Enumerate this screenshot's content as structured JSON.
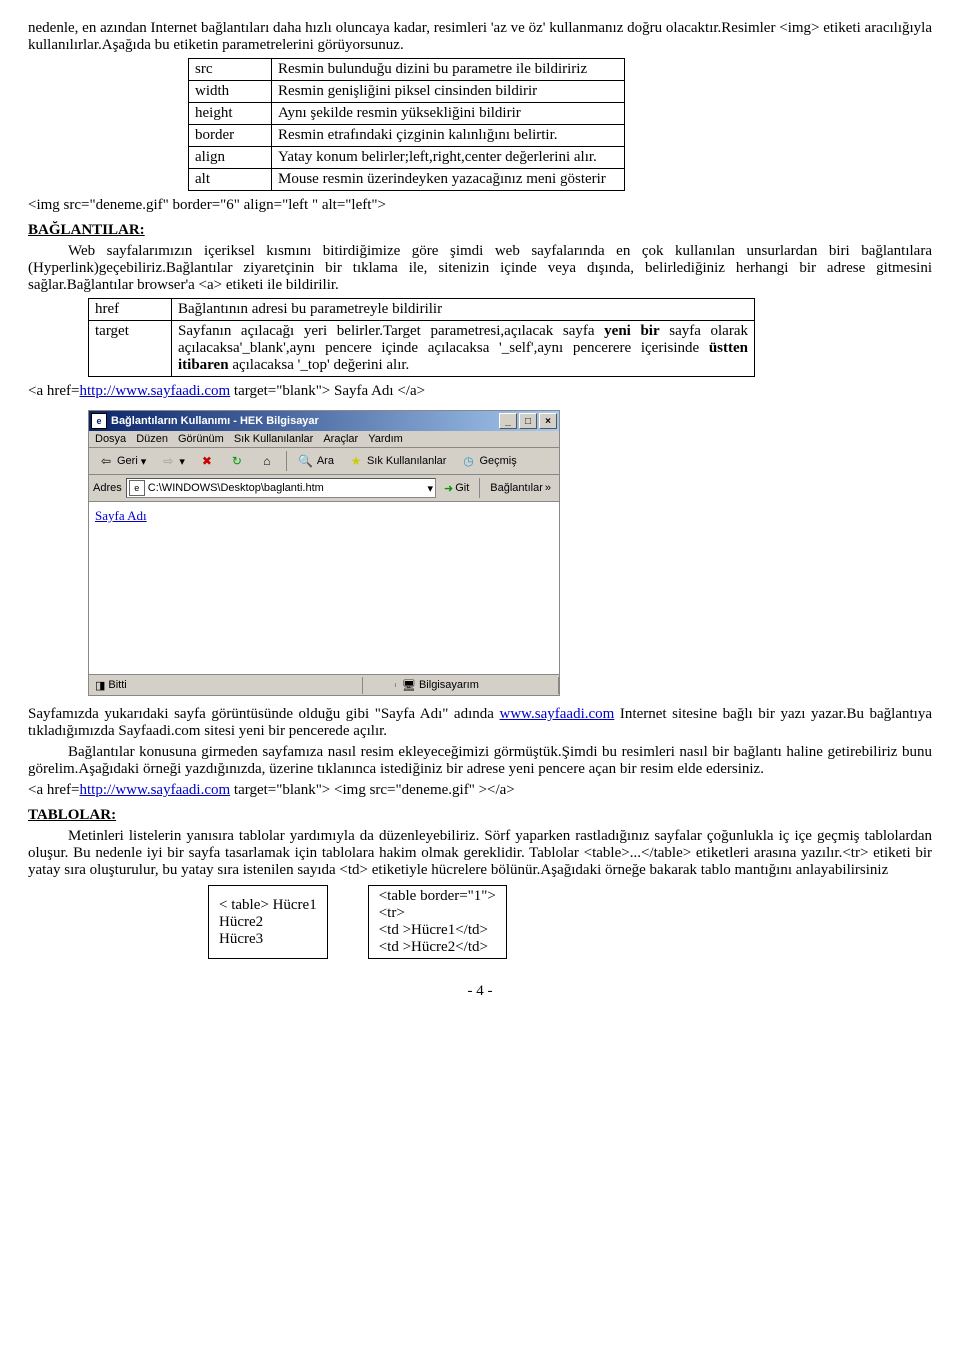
{
  "intro_para": "nedenle, en azından Internet bağlantıları daha hızlı oluncaya kadar, resimleri 'az ve öz' kullanmanız doğru olacaktır.Resimler <img> etiketi aracılığıyla kullanılırlar.Aşağıda bu etiketin parametrelerini görüyorsunuz.",
  "img_params": [
    {
      "k": "src",
      "v": "Resmin bulunduğu dizini bu parametre ile bildiririz"
    },
    {
      "k": "width",
      "v": "Resmin genişliğini piksel cinsinden bildirir"
    },
    {
      "k": "height",
      "v": "Aynı şekilde resmin yüksekliğini bildirir"
    },
    {
      "k": "border",
      "v": "Resmin etrafındaki çizginin kalınlığını belirtir."
    },
    {
      "k": "align",
      "v": "Yatay konum belirler;left,right,center değerlerini alır."
    },
    {
      "k": "alt",
      "v": "Mouse resmin üzerindeyken yazacağınız meni gösterir"
    }
  ],
  "img_code": "<img src=\"deneme.gif\" border=\"6\" align=\"left \" alt=\"left\">",
  "sec_links_title": "BAĞLANTILAR:",
  "links_para": "Web sayfalarımızın içeriksel kısmını bitirdiğimize göre şimdi web sayfalarında en çok kullanılan unsurlardan biri bağlantılara (Hyperlink)geçebiliriz.Bağlantılar ziyaretçinin bir tıklama ile, sitenizin içinde veya dışında, belirlediğiniz herhangi bir adrese gitmesini sağlar.Bağlantılar browser'a <a> etiketi ile bildirilir.",
  "link_params": [
    {
      "k": "href",
      "v": "Bağlantının adresi bu parametreyle bildirilir"
    },
    {
      "k": "target",
      "v": "Sayfanın açılacağı yeri belirler.Target parametresi,açılacak sayfa yeni bir sayfa olarak açılacaksa'_blank',aynı pencere içinde açılacaksa '_self',aynı pencerere içerisinde üstten itibaren açılacaksa '_top' değerini alır."
    }
  ],
  "link_code_pre": "<a href=",
  "link_code_url": "http://www.sayfaadi.com",
  "link_code_post": " target=\"blank\"> Sayfa Adı </a>",
  "browser": {
    "title": "Bağlantıların Kullanımı - HEK Bilgisayar",
    "menus": [
      "Dosya",
      "Düzen",
      "Görünüm",
      "Sık Kullanılanlar",
      "Araçlar",
      "Yardım"
    ],
    "tb_back": "Geri",
    "tb_stop": "Dur",
    "tb_home": "",
    "tb_search": "Ara",
    "tb_fav": "Sık Kullanılanlar",
    "tb_history": "Geçmiş",
    "addr_label": "Adres",
    "addr_value": "C:\\WINDOWS\\Desktop\\baglanti.htm",
    "go_btn": "Git",
    "links_btn": "Bağlantılar",
    "content_link": "Sayfa Adı",
    "status_left": "Bitti",
    "status_right": "Bilgisayarım"
  },
  "after_browser_p1_a": "Sayfamızda yukarıdaki sayfa görüntüsünde olduğu gibi \"Sayfa Adı\" adında ",
  "after_browser_link1": "www.sayfaadi.com",
  "after_browser_p1_b": " Internet sitesine bağlı bir yazı yazar.Bu bağlantıya tıkladığımızda Sayfaadi.com sitesi yeni bir pencerede açılır.",
  "after_browser_p2": "Bağlantılar konusuna girmeden sayfamıza nasıl resim ekleyeceğimizi görmüştük.Şimdi bu resimleri nasıl bir bağlantı haline getirebiliriz bunu görelim.Aşağıdaki örneği yazdığınızda, üzerine tıklanınca istediğiniz bir adrese yeni pencere açan bir resim elde edersiniz.",
  "img_link_pre": "<a href=",
  "img_link_url": "http://www.sayfaadi.com",
  "img_link_post": " target=\"blank\"> <img src=\"deneme.gif\" ></a>",
  "sec_tables_title": "TABLOLAR:",
  "tables_para": "Metinleri listelerin yanısıra tablolar yardımıyla da düzenleyebiliriz. Sörf yaparken rastladığınız sayfalar çoğunlukla iç içe geçmiş tablolardan oluşur. Bu nedenle iyi bir sayfa tasarlamak için tablolara hakim olmak gereklidir.        Tablolar <table>...</table> etiketleri arasına yazılır.<tr> etiketi bir yatay sıra oluşturulur, bu yatay sıra istenilen sayıda <td> etiketiyle hücrelere bölünür.Aşağıdaki örneğe bakarak tablo mantığını anlayabilirsiniz",
  "tbl_left": [
    "< table> Hücre1",
    "Hücre2",
    "Hücre3"
  ],
  "tbl_right": [
    "<table border=\"1\">",
    "<tr>",
    "<td >Hücre1</td>",
    "<td >Hücre2</td>"
  ],
  "page_num": "- 4 -"
}
